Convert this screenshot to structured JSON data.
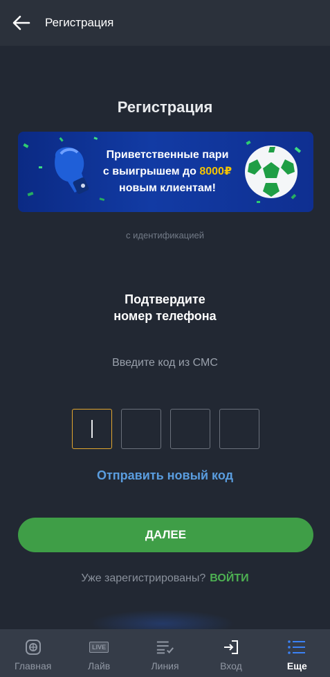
{
  "header": {
    "title": "Регистрация"
  },
  "page": {
    "heading": "Регистрация"
  },
  "banner": {
    "line1": "Приветственные пари",
    "line2_prefix": "с выигрышем до ",
    "line2_amount": "8000₽",
    "line3": "новым клиентам!"
  },
  "identification_note": "с идентификацией",
  "confirm": {
    "line1": "Подтвердите",
    "line2": "номер телефона"
  },
  "sms_hint": "Введите код из СМС",
  "code": {
    "digits": [
      "",
      "",
      "",
      ""
    ]
  },
  "resend_label": "Отправить новый код",
  "next_label": "ДАЛЕЕ",
  "login": {
    "question": "Уже зарегистрированы?",
    "link": "ВОЙТИ"
  },
  "tabs": [
    {
      "label": "Главная",
      "icon": "home-icon"
    },
    {
      "label": "Лайв",
      "icon": "live-icon",
      "badge": "LIVE"
    },
    {
      "label": "Линия",
      "icon": "line-list-icon"
    },
    {
      "label": "Вход",
      "icon": "login-icon"
    },
    {
      "label": "Еще",
      "icon": "more-menu-icon",
      "active": true
    }
  ],
  "colors": {
    "background": "#222833",
    "accent_green": "#3f9e47",
    "link_blue": "#5a9ddf",
    "active_border": "#e3a72f",
    "highlight_yellow": "#f5c400"
  }
}
